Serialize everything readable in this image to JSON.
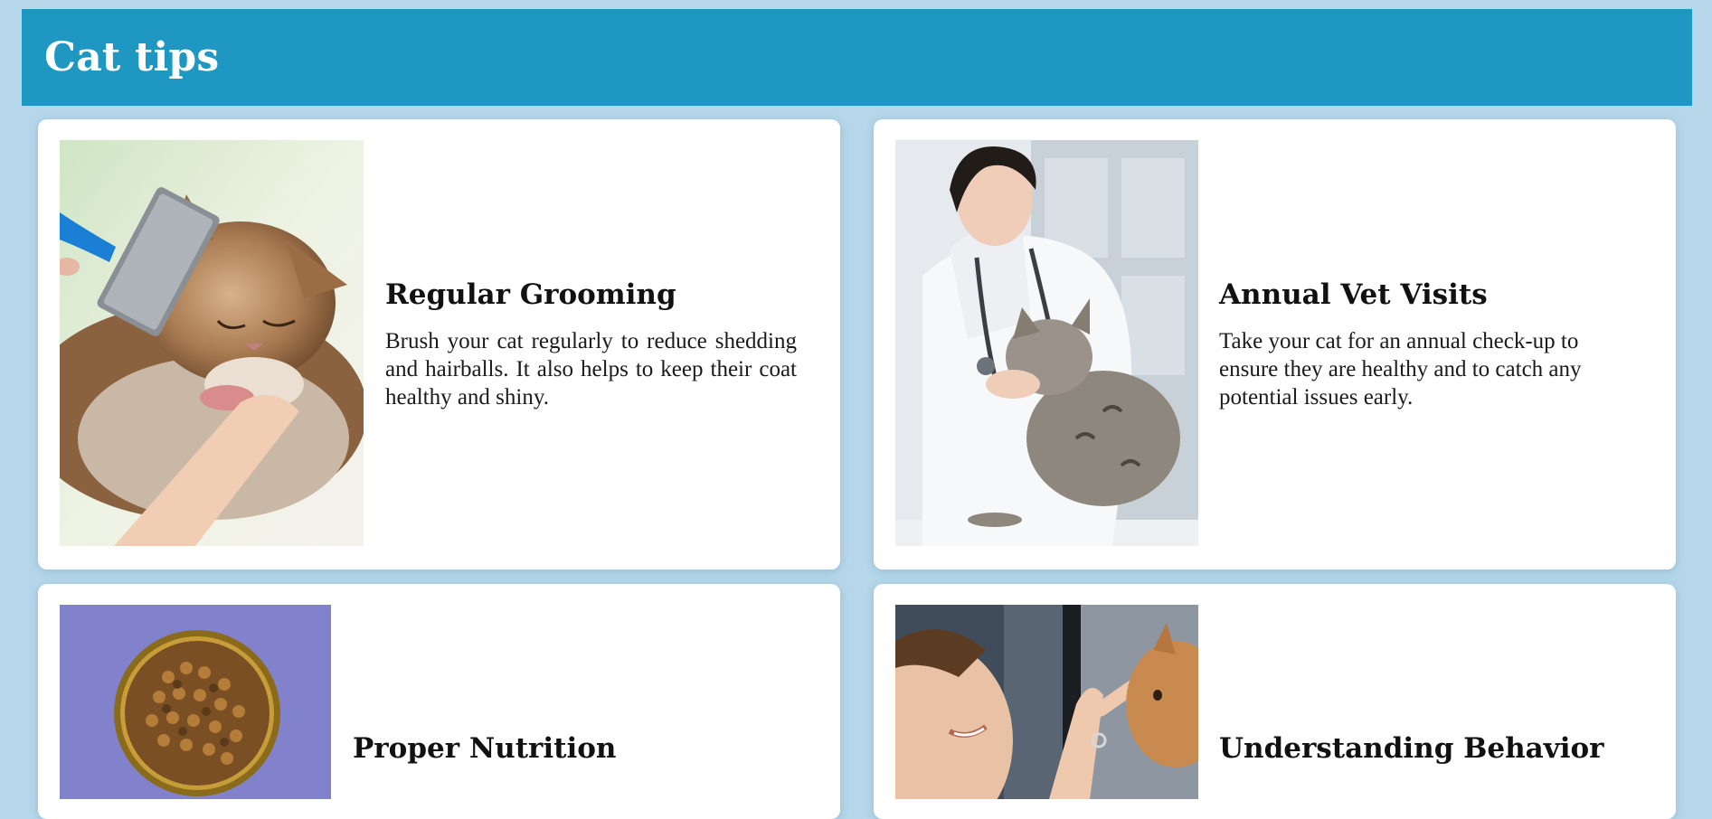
{
  "header": {
    "title": "Cat tips"
  },
  "cards": [
    {
      "title": "Regular Grooming",
      "text": "Brush your cat regularly to reduce shedding and hairballs. It also helps to keep their coat healthy and shiny.",
      "image": "cat-grooming-photo"
    },
    {
      "title": "Annual Vet Visits",
      "text": "Take your cat for an annual check-up to ensure they are healthy and to catch any potential issues early.",
      "image": "vet-with-cat-photo"
    },
    {
      "title": "Proper Nutrition",
      "image": "cat-food-bowl-photo"
    },
    {
      "title": "Understanding Behavior",
      "image": "woman-with-kitten-photo"
    }
  ],
  "colors": {
    "page_background": "#b6d7ea",
    "header_background": "#1e98c3",
    "card_background": "#ffffff"
  }
}
